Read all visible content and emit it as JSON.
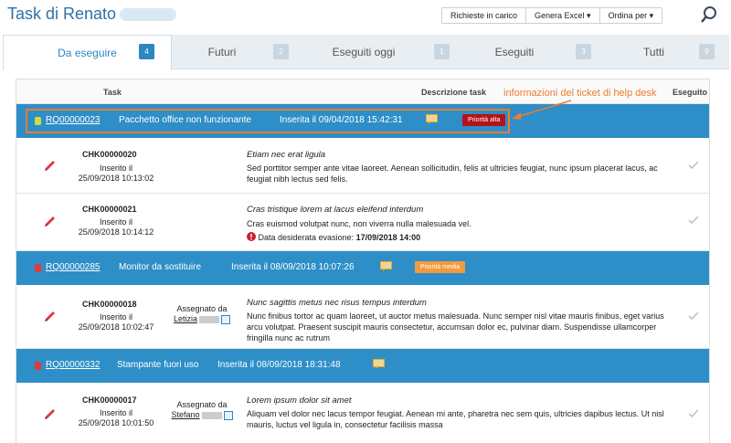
{
  "header": {
    "title": "Task di Renato",
    "toolbar": {
      "richieste": "Richieste in carico",
      "genera": "Genera Excel ▾",
      "ordina": "Ordina per ▾"
    }
  },
  "tabs": [
    {
      "label": "Da eseguire",
      "count": "4"
    },
    {
      "label": "Futuri",
      "count": "2"
    },
    {
      "label": "Eseguiti oggi",
      "count": "1"
    },
    {
      "label": "Eseguiti",
      "count": "3"
    },
    {
      "label": "Tutti",
      "count": "9"
    }
  ],
  "columns": {
    "task": "Task",
    "descrizione": "Descrizione task",
    "eseguito": "Eseguito"
  },
  "annotation": "informazioni del ticket di help desk",
  "tickets": [
    {
      "id": "RQ00000023",
      "subject": "Pacchetto office non funzionante",
      "inserted": "Inserita il 09/04/2018 15:42:31",
      "priority": "Priorità alta",
      "priority_color": "#b5121b",
      "led_color": "#c9e03d"
    },
    {
      "id": "RQ00000285",
      "subject": "Monitor da sostituire",
      "inserted": "Inserita il 08/09/2018 10:07:26",
      "priority": "Priorità media",
      "priority_color": "#f39a3c",
      "led_color": "#e03a3a"
    },
    {
      "id": "RQ00000332",
      "subject": "Stampante fuori uso",
      "inserted": "Inserita il 08/09/2018 18:31:48",
      "priority": "",
      "priority_color": "",
      "led_color": "#e03a3a"
    }
  ],
  "tasks": [
    {
      "code": "CHK00000020",
      "ins_label": "Inserito il",
      "date": "25/09/2018 10:13:02",
      "assigned": "",
      "assigned_name": "",
      "title": "Etiam nec erat ligula",
      "desc": "Sed porttitor semper ante vitae laoreet. Aenean sollicitudin, felis at ultricies feugiat, nunc ipsum placerat lacus, ac feugiat nibh lectus sed felis.",
      "deadline_label": "",
      "deadline": ""
    },
    {
      "code": "CHK00000021",
      "ins_label": "Inserito il",
      "date": "25/09/2018 10:14:12",
      "assigned": "",
      "assigned_name": "",
      "title": "Cras tristique lorem at lacus eleifend interdum",
      "desc": "Cras euismod volutpat nunc, non viverra nulla malesuada vel.",
      "deadline_label": "Data desiderata evasione:",
      "deadline": "17/09/2018 14:00"
    },
    {
      "code": "CHK00000018",
      "ins_label": "Inserito il",
      "date": "25/09/2018 10:02:47",
      "assigned": "Assegnato da",
      "assigned_name": "Letizia",
      "title": "Nunc sagittis metus nec risus tempus interdum",
      "desc": "Nunc finibus tortor ac quam laoreet, ut auctor metus malesuada. Nunc semper nisl vitae mauris finibus, eget varius arcu volutpat. Praesent suscipit mauris consectetur, accumsan dolor ec, pulvinar diam. Suspendisse ullamcorper fringilla nunc ac rutrum",
      "deadline_label": "",
      "deadline": ""
    },
    {
      "code": "CHK00000017",
      "ins_label": "Inserito il",
      "date": "25/09/2018 10:01:50",
      "assigned": "Assegnato da",
      "assigned_name": "Stefano",
      "title": "Lorem ipsum dolor sit amet",
      "desc": "Aliquam vel dolor nec lacus tempor feugiat. Aenean mi ante, pharetra nec sem quis, ultricies dapibus lectus. Ut nisl mauris, luctus vel ligula in, consectetur facilisis massa",
      "deadline_label": "",
      "deadline": ""
    }
  ]
}
